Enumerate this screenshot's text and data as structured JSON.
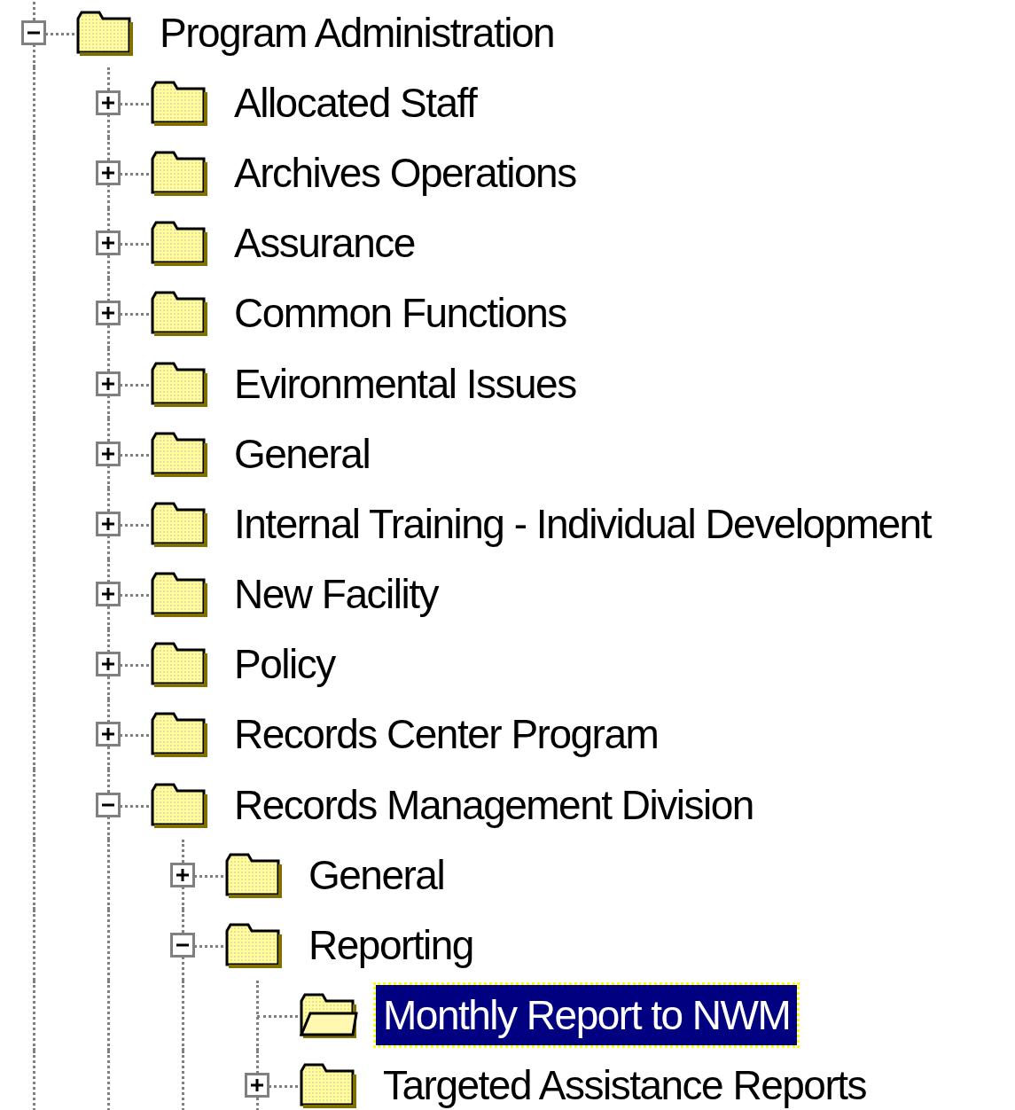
{
  "tree": [
    {
      "label": "Program Administration",
      "expanded": true,
      "has_children": true,
      "selected": false,
      "children": [
        {
          "label": "Allocated Staff",
          "expanded": false,
          "has_children": true,
          "selected": false
        },
        {
          "label": "Archives Operations",
          "expanded": false,
          "has_children": true,
          "selected": false
        },
        {
          "label": "Assurance",
          "expanded": false,
          "has_children": true,
          "selected": false
        },
        {
          "label": "Common Functions",
          "expanded": false,
          "has_children": true,
          "selected": false
        },
        {
          "label": "Evironmental Issues",
          "expanded": false,
          "has_children": true,
          "selected": false
        },
        {
          "label": "General",
          "expanded": false,
          "has_children": true,
          "selected": false
        },
        {
          "label": "Internal Training - Individual Development",
          "expanded": false,
          "has_children": true,
          "selected": false
        },
        {
          "label": "New Facility",
          "expanded": false,
          "has_children": true,
          "selected": false
        },
        {
          "label": "Policy",
          "expanded": false,
          "has_children": true,
          "selected": false
        },
        {
          "label": "Records Center Program",
          "expanded": false,
          "has_children": true,
          "selected": false
        },
        {
          "label": "Records Management Division",
          "expanded": true,
          "has_children": true,
          "selected": false,
          "children": [
            {
              "label": "General",
              "expanded": false,
              "has_children": true,
              "selected": false
            },
            {
              "label": "Reporting",
              "expanded": true,
              "has_children": true,
              "selected": false,
              "children": [
                {
                  "label": "Monthly Report to NWM",
                  "expanded": false,
                  "has_children": false,
                  "selected": true
                },
                {
                  "label": "Targeted Assistance Reports",
                  "expanded": false,
                  "has_children": true,
                  "selected": false
                }
              ]
            }
          ]
        }
      ]
    }
  ]
}
